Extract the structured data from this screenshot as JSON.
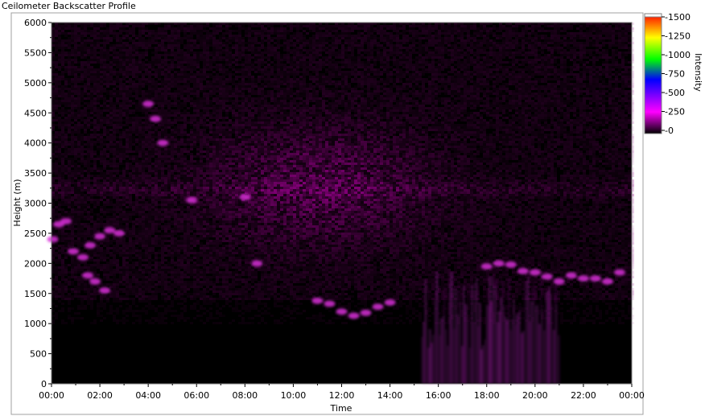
{
  "window": {
    "title": "Ceilometer Backscatter Profile"
  },
  "colors": {
    "background": "#000000",
    "noise": "#8b007f",
    "layer": "#d830d8",
    "precip": "#b022b8",
    "colorbar_stops": [
      "#000000",
      "#ff00ff",
      "#0000ff",
      "#00ff00",
      "#ffff00",
      "#ff0000"
    ]
  },
  "chart_data": {
    "type": "heatmap",
    "title": "Ceilometer Backscatter Profile",
    "xlabel": "Time",
    "ylabel": "Height (m)",
    "xlim": [
      0,
      24
    ],
    "ylim": [
      0,
      6000
    ],
    "x_ticks": [
      "00:00",
      "02:00",
      "04:00",
      "06:00",
      "08:00",
      "10:00",
      "12:00",
      "14:00",
      "16:00",
      "18:00",
      "20:00",
      "22:00",
      "00:00"
    ],
    "y_ticks": [
      "0",
      "500",
      "1000",
      "1500",
      "2000",
      "2500",
      "3000",
      "3500",
      "4000",
      "4500",
      "5000",
      "5500",
      "6000"
    ],
    "colorbar": {
      "label": "Intensity",
      "ticks": [
        "-0",
        "-250",
        "-500",
        "-750",
        "-1000",
        "-1250",
        "-1500"
      ],
      "range": [
        0,
        1500
      ]
    },
    "features": [
      {
        "name": "cloud layer",
        "points": [
          [
            0.05,
            2400
          ],
          [
            0.3,
            2650
          ],
          [
            0.6,
            2700
          ],
          [
            0.9,
            2200
          ],
          [
            1.3,
            2100
          ],
          [
            1.6,
            2300
          ],
          [
            2.0,
            2450
          ],
          [
            2.4,
            2550
          ],
          [
            2.8,
            2500
          ]
        ]
      },
      {
        "name": "cloud fragments",
        "points": [
          [
            1.5,
            1800
          ],
          [
            1.8,
            1700
          ],
          [
            2.2,
            1550
          ],
          [
            4.0,
            4650
          ],
          [
            4.3,
            4400
          ],
          [
            4.6,
            4000
          ],
          [
            5.8,
            3050
          ],
          [
            8.0,
            3100
          ],
          [
            8.5,
            2000
          ]
        ]
      },
      {
        "name": "low cloud",
        "points": [
          [
            11.0,
            1380
          ],
          [
            11.5,
            1330
          ],
          [
            12.0,
            1200
          ],
          [
            12.5,
            1130
          ],
          [
            13.0,
            1180
          ],
          [
            13.5,
            1280
          ],
          [
            14.0,
            1350
          ]
        ]
      },
      {
        "name": "evening layer",
        "points": [
          [
            18.0,
            1950
          ],
          [
            18.5,
            2000
          ],
          [
            19.0,
            1980
          ],
          [
            19.5,
            1870
          ],
          [
            20.0,
            1850
          ],
          [
            20.5,
            1780
          ],
          [
            21.0,
            1700
          ],
          [
            21.5,
            1800
          ],
          [
            22.0,
            1750
          ],
          [
            22.5,
            1750
          ],
          [
            23.0,
            1700
          ],
          [
            23.5,
            1850
          ]
        ]
      },
      {
        "name": "precipitation",
        "range": [
          15.3,
          21.0
        ],
        "top": 1900
      }
    ]
  }
}
